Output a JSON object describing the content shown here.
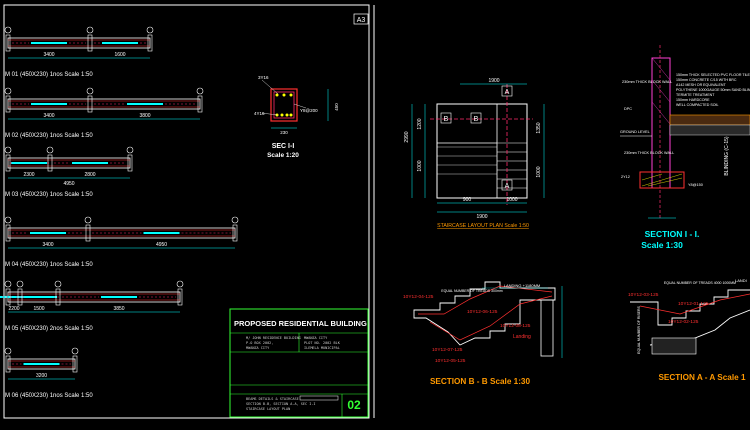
{
  "sheet": {
    "size_label": "A3",
    "title_block": {
      "project_title": "PROPOSED RESIDENTIAL BUILDING",
      "sheet_number": "02",
      "client_lines": [
        "M/ JOHN RESIDENCE BUILDING",
        "P.O BOX 2002,",
        "MWANZA CITY"
      ],
      "location_lines": [
        "MWANZA CITY",
        "PLOT NO. 2002 BLK",
        "ILEMELA MUNICIPAL"
      ],
      "drawing_lines": [
        "BEAMS DETAILS & STAIRCASE",
        "SECTION B-B, SECTION A-A, SEC I-I",
        "STAIRCASE LAYOUT PLAN"
      ]
    }
  },
  "beams": [
    {
      "label": "M 01 (450X230) 1nos Scale 1:50",
      "dims": [
        "3400",
        "1600"
      ]
    },
    {
      "label": "M 02 (450X230) 1nos Scale 1:50",
      "dims": [
        "3400",
        "3800"
      ]
    },
    {
      "label": "M 03 (450X230) 1nos Scale 1:50",
      "dims": [
        "2300",
        "2800",
        "4950"
      ]
    },
    {
      "label": "M 04 (450X230) 1nos Scale 1:50",
      "dims": [
        "3400",
        "4950"
      ]
    },
    {
      "label": "M 05 (450X230) 2nos Scale 1:50",
      "dims": [
        "2200",
        "1500",
        "3850"
      ]
    },
    {
      "label": "M 06 (450X230) 1nos Scale 1:50",
      "dims": [
        "3200"
      ]
    }
  ],
  "sec_beam": {
    "title": "SEC I-I",
    "scale": "Scale 1:20",
    "top_bars": "3Y16",
    "bottom_bars": "4Y16",
    "stirrups": "Y8@200",
    "width": "230",
    "depth": "450"
  },
  "stair_plan": {
    "title": "STAIRCASE LAYOUT PLAN Scale 1:50",
    "dims": {
      "top": "1900",
      "bottom": "1900",
      "left_total": "2990",
      "left_a": "1200",
      "left_b": "1000",
      "bottom_a": "900",
      "bottom_b": "1000",
      "right_a": "1350",
      "right_b": "1000"
    },
    "marks": [
      "A",
      "A",
      "B",
      "B"
    ]
  },
  "section_ii": {
    "title": "SECTION  I - I.",
    "scale": "Scale 1:30",
    "labels": [
      "230mm THICK BLOCK WALL",
      "DPC",
      "GROUND LEVEL",
      "230mm THICK BLOCK WALL",
      "2Y12",
      "Y8@150"
    ],
    "notes": [
      "150mm THICK SELECTED PVC FLOOR TILES",
      "150mm CONCRETE C/15 WITH BRC",
      "A142 MESH OR EQUIVALENT",
      "POLYTHENE 1000GAUGE 50mm SAND BLINDING",
      "TERMITE TREATMENT",
      "150mm HARDCORE",
      "WELL COMPACTED SOIL"
    ],
    "vertical_label": "BLINDING (C-15)"
  },
  "section_bb": {
    "title": "SECTION B - B Scale 1:30",
    "landing_label": "LANDING +1180MM",
    "treads_note": "EQUAL NUMBER OF TREADS 300mm",
    "bars": [
      "10Y12-04-125",
      "10Y12-06-125",
      "10Y12-07-125",
      "10Y12-05-125",
      "10Y12-08-125"
    ],
    "landing_word": "Landing"
  },
  "section_aa": {
    "title": "SECTION A - A Scale 1",
    "landing_label": "LANDI",
    "treads_note": "EQUAL NUMBER OF TREADS 4000 1000MM",
    "bars": [
      "10Y12-01-125",
      "10Y12-02-125",
      "10Y12-03-125"
    ],
    "side_note": "EQUAL NUMBER OF RISERS"
  },
  "colors": {
    "background": "#000000",
    "frame": "#ffffff",
    "title_block": "#33ff33",
    "dim": "#00ffff",
    "text": "#ffffff",
    "accent": "#ff2b6b",
    "wall": "#ff3fd4",
    "rebar": "#ff3030",
    "annotation": "#ffff00",
    "orange": "#ff9900"
  }
}
